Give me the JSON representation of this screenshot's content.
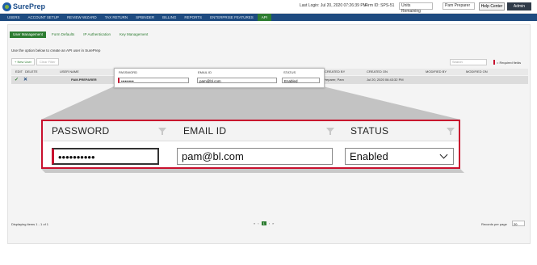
{
  "header": {
    "logo_text": "SurePrep",
    "last_login": "Last Login: Jul 20, 2020 07:26:39 PM",
    "firm_id": "Firm ID: SPS-51",
    "units_select": "Units Remaining",
    "user_select": "Pam Preparer",
    "help_label": "Help Center",
    "admin_label": "Admin"
  },
  "nav": {
    "items": [
      "USERS",
      "ACCOUNT SETUP",
      "REVIEW WIZARD",
      "TAX RETURN",
      "SPBINDER",
      "BILLING",
      "REPORTS",
      "ENTERPRISE FEATURES",
      "API"
    ],
    "active": "API"
  },
  "subtabs": [
    "User Management",
    "Form Defaults",
    "IP Authentication",
    "Key Management"
  ],
  "intro_text": "Use the option below to create an API user in SurePrep",
  "buttons": {
    "new_user": "+ New User",
    "clear_filter": "Clear Filter"
  },
  "search_placeholder": "Search",
  "required_label": "= Required fields",
  "table": {
    "headers": [
      "EDIT",
      "DELETE",
      "USER NAME",
      "CREATED BY",
      "CREATED ON",
      "MODIFIED BY",
      "MODIFIED ON"
    ],
    "row": {
      "user_name": "PAM.PREPARER",
      "created_by": "Preparer, Pam",
      "created_on": "Jul 20, 2020 06:43:32 PM"
    }
  },
  "small_popup": {
    "headers": [
      "PASSWORD",
      "EMAIL ID",
      "STATUS"
    ],
    "password": "••••••••••",
    "email": "pam@bl.com",
    "status": "Enabled"
  },
  "big_popup": {
    "headers": [
      "PASSWORD",
      "EMAIL ID",
      "STATUS"
    ],
    "password": "••••••••••",
    "email": "pam@bl.com",
    "status": "Enabled"
  },
  "footer": {
    "displaying": "Displaying items 1 - 1 of 1",
    "pages": [
      "«",
      "‹",
      "1",
      "›",
      "»"
    ],
    "records_label": "Records per page",
    "records_value": "20"
  },
  "colors": {
    "nav": "#1e4b80",
    "accent": "#2e7d32",
    "highlight": "#c8102e"
  }
}
